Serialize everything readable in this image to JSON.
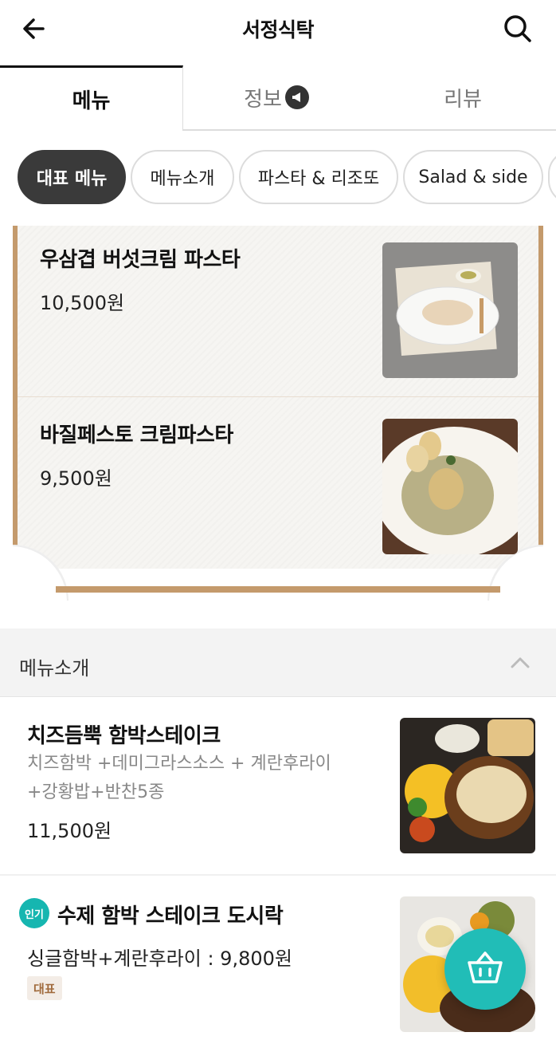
{
  "header": {
    "title": "서정식탁"
  },
  "tabs": [
    {
      "label": "메뉴"
    },
    {
      "label": "정보"
    },
    {
      "label": "리뷰"
    }
  ],
  "chips": [
    {
      "label": "대표 메뉴"
    },
    {
      "label": "메뉴소개"
    },
    {
      "label": "파스타 & 리조또"
    },
    {
      "label": "Salad & side"
    }
  ],
  "signature": {
    "items": [
      {
        "name": "우삼겹 버섯크림 파스타",
        "price": "10,500원"
      },
      {
        "name": "바질페스토 크림파스타",
        "price": "9,500원"
      }
    ]
  },
  "section": {
    "label": "메뉴소개"
  },
  "menu_items": [
    {
      "name": "치즈듬뿍 함박스테이크",
      "desc": "치즈함박 +데미그라스소스 + 계란후라이 +강황밥+반찬5종",
      "price": "11,500원"
    },
    {
      "badge": "인기",
      "name": "수제 함박 스테이크 도시락",
      "price": "싱글함박+계란후라이 : 9,800원",
      "tag": "대표"
    }
  ],
  "colors": {
    "accent": "#21bdb7",
    "board_frame": "#c49a6c",
    "active_chip": "#3a3a3a"
  },
  "icons": [
    "back-arrow-icon",
    "search-icon",
    "megaphone-icon",
    "chevron-up-icon",
    "basket-icon"
  ]
}
